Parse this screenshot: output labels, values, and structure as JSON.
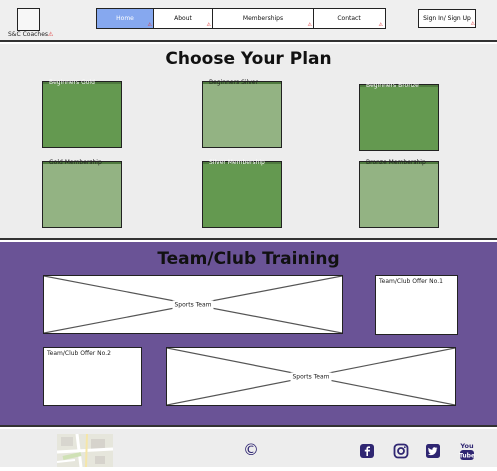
{
  "header": {
    "logo_caption": "S&C Coaches",
    "nav": [
      {
        "label": "Home",
        "active": true
      },
      {
        "label": "About",
        "active": false
      },
      {
        "label": "Memberships",
        "active": false
      },
      {
        "label": "Contact",
        "active": false
      }
    ],
    "signin_label": "Sign In/ Sign Up"
  },
  "plans": {
    "title": "Choose Your Plan",
    "items": [
      {
        "label": "Beginners Gold",
        "tone": "dark"
      },
      {
        "label": "Beginners Silver",
        "tone": "light"
      },
      {
        "label": "Beginners Bronze",
        "tone": "dark"
      },
      {
        "label": "Gold Membership",
        "tone": "light"
      },
      {
        "label": "Silver Membership",
        "tone": "dark"
      },
      {
        "label": "Bronze Membership",
        "tone": "light"
      }
    ]
  },
  "team": {
    "title": "Team/Club Training",
    "image_caption_1": "Sports Team",
    "offer_1": "Team/Club Offer No.1",
    "offer_2": "Team/Club Offer No.2",
    "image_caption_2": "Sports Team"
  },
  "footer": {
    "copyright": "©",
    "icons": [
      "facebook-icon",
      "instagram-icon",
      "twitter-icon",
      "youtube-icon"
    ]
  },
  "colors": {
    "nav_active": "#86a8ef",
    "plan_dark": "#649950",
    "plan_light": "#93b383",
    "team_bg": "#6a5396",
    "icon_color": "#2f2672"
  }
}
